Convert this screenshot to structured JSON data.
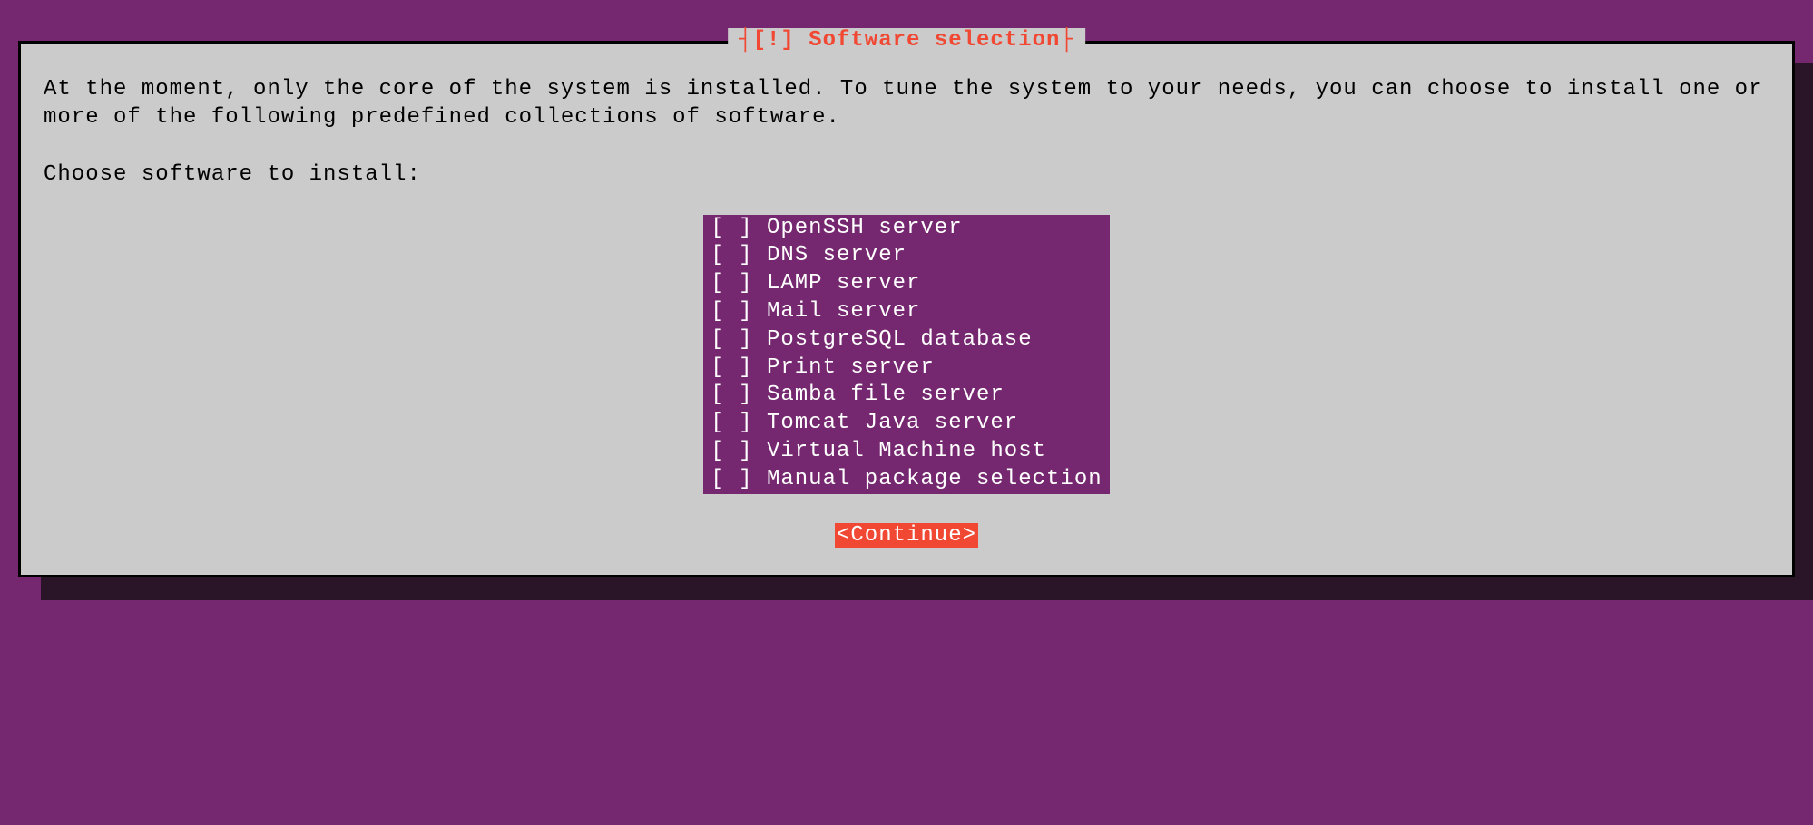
{
  "dialog": {
    "title_bracket_left": "┤ ",
    "title": "[!] Software selection",
    "title_bracket_right": " ├",
    "description": "At the moment, only the core of the system is installed. To tune the system to your needs, you can choose to install one or more of the following predefined collections of software.",
    "prompt": "Choose software to install:",
    "options": [
      {
        "checked": false,
        "label": "OpenSSH server"
      },
      {
        "checked": false,
        "label": "DNS server"
      },
      {
        "checked": false,
        "label": "LAMP server"
      },
      {
        "checked": false,
        "label": "Mail server"
      },
      {
        "checked": false,
        "label": "PostgreSQL database"
      },
      {
        "checked": false,
        "label": "Print server"
      },
      {
        "checked": false,
        "label": "Samba file server"
      },
      {
        "checked": false,
        "label": "Tomcat Java server"
      },
      {
        "checked": false,
        "label": "Virtual Machine host"
      },
      {
        "checked": false,
        "label": "Manual package selection"
      }
    ],
    "continue_label": "<Continue>"
  },
  "colors": {
    "background": "#75286f",
    "dialog_bg": "#cbcbcb",
    "accent_red": "#f04833",
    "selection_bg": "#75286f",
    "shadow": "#2a1528"
  }
}
